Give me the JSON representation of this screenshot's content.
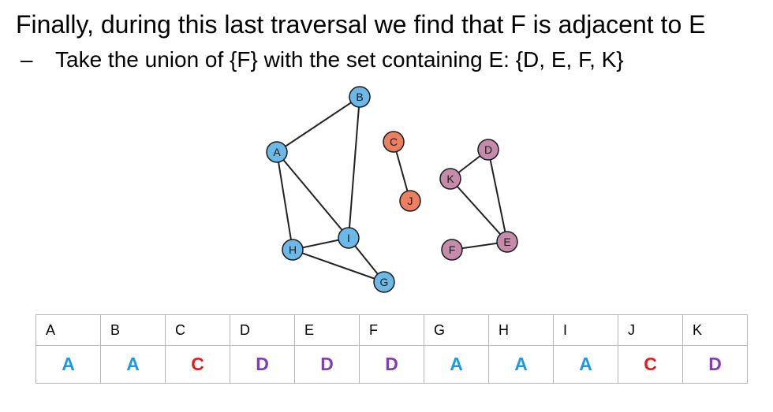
{
  "title": "Finally, during this last traversal we find that F is adjacent to E",
  "bullet": {
    "dash": "–",
    "text": "Take the union of {F} with the set containing E: {D, E, F, K}"
  },
  "colors": {
    "blue": "#6cb8e6",
    "orange": "#ea7f61",
    "purple": "#c48bab",
    "edge": "#222222",
    "set_blue": "#1a9be0",
    "set_red": "#e8181b",
    "set_purple": "#7f3fb0"
  },
  "graph": {
    "nodes": [
      {
        "id": "A",
        "label": "A",
        "color": "blue"
      },
      {
        "id": "B",
        "label": "B",
        "color": "blue"
      },
      {
        "id": "C",
        "label": "C",
        "color": "orange"
      },
      {
        "id": "D",
        "label": "D",
        "color": "purple"
      },
      {
        "id": "E",
        "label": "E",
        "color": "purple"
      },
      {
        "id": "F",
        "label": "F",
        "color": "purple"
      },
      {
        "id": "G",
        "label": "G",
        "color": "blue"
      },
      {
        "id": "H",
        "label": "H",
        "color": "blue"
      },
      {
        "id": "I",
        "label": "I",
        "color": "blue"
      },
      {
        "id": "J",
        "label": "J",
        "color": "orange"
      },
      {
        "id": "K",
        "label": "K",
        "color": "purple"
      }
    ],
    "edges": [
      [
        "A",
        "B"
      ],
      [
        "A",
        "H"
      ],
      [
        "A",
        "I"
      ],
      [
        "B",
        "I"
      ],
      [
        "H",
        "I"
      ],
      [
        "H",
        "G"
      ],
      [
        "I",
        "G"
      ],
      [
        "C",
        "J"
      ],
      [
        "K",
        "D"
      ],
      [
        "K",
        "E"
      ],
      [
        "D",
        "E"
      ],
      [
        "F",
        "E"
      ]
    ]
  },
  "table": {
    "headers": [
      "A",
      "B",
      "C",
      "D",
      "E",
      "F",
      "G",
      "H",
      "I",
      "J",
      "K"
    ],
    "values": [
      {
        "text": "A",
        "color": "set_blue"
      },
      {
        "text": "A",
        "color": "set_blue"
      },
      {
        "text": "C",
        "color": "set_red"
      },
      {
        "text": "D",
        "color": "set_purple"
      },
      {
        "text": "D",
        "color": "set_purple"
      },
      {
        "text": "D",
        "color": "set_purple"
      },
      {
        "text": "A",
        "color": "set_blue"
      },
      {
        "text": "A",
        "color": "set_blue"
      },
      {
        "text": "A",
        "color": "set_blue"
      },
      {
        "text": "C",
        "color": "set_red"
      },
      {
        "text": "D",
        "color": "set_purple"
      }
    ]
  }
}
